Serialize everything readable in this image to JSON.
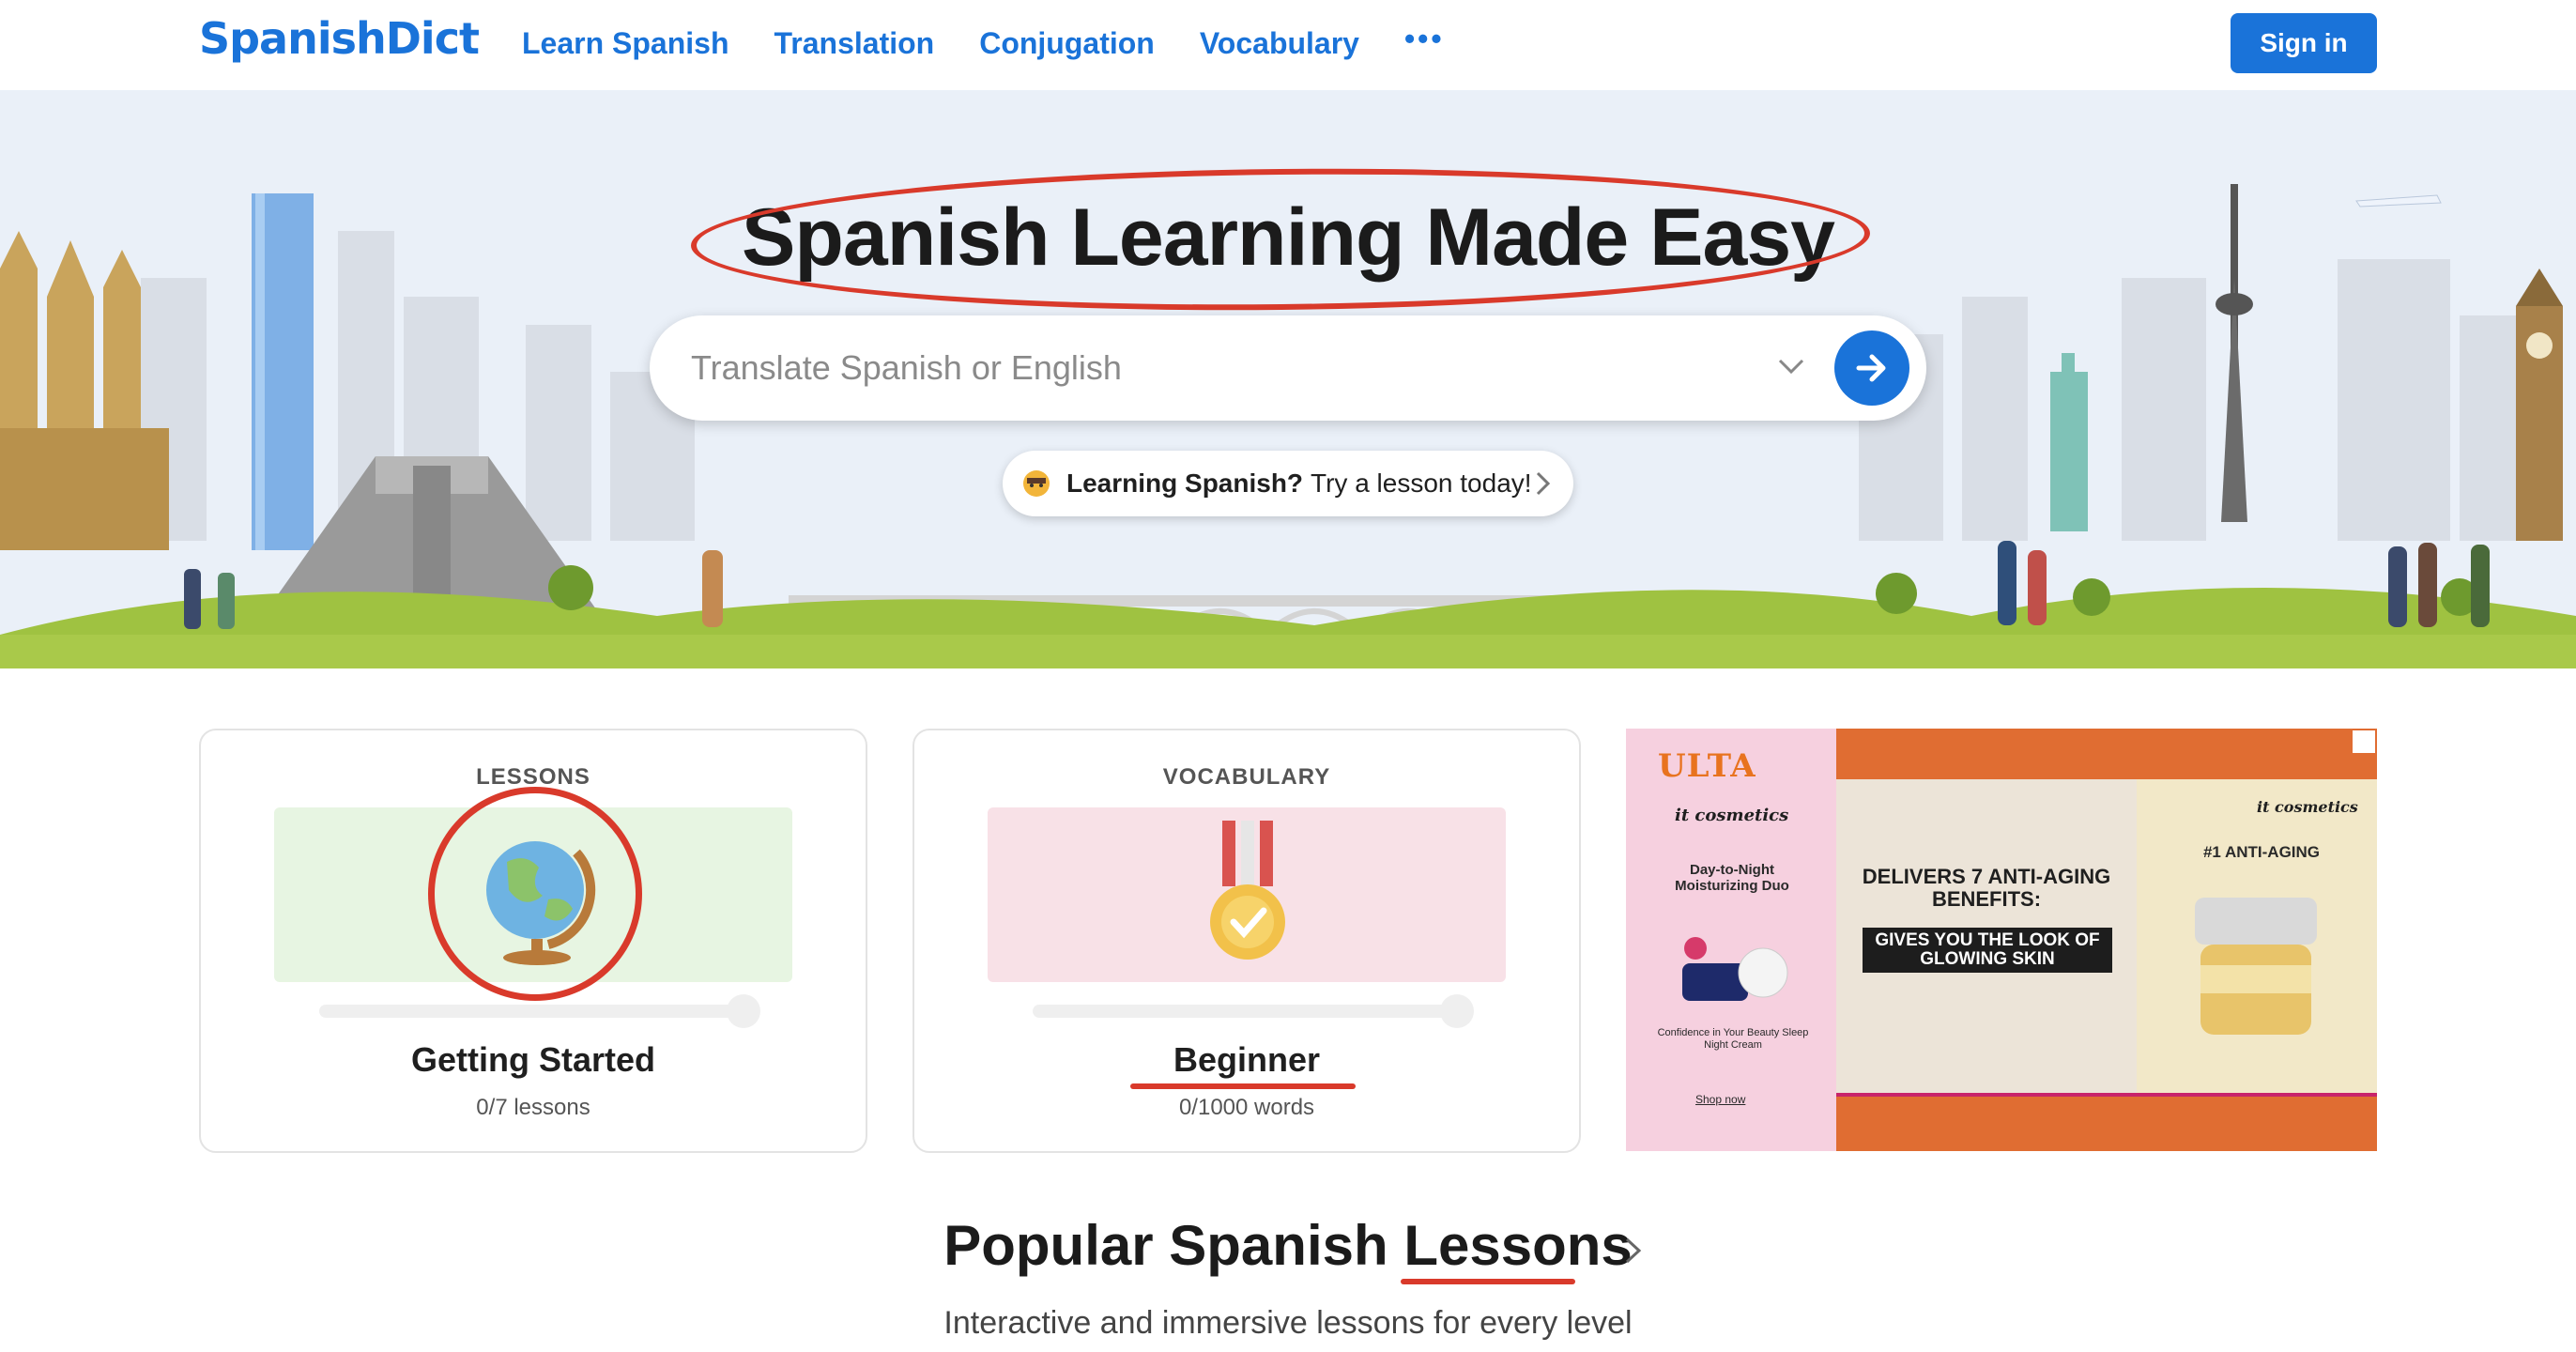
{
  "nav": {
    "logo": "SpanishDict",
    "links": [
      "Learn Spanish",
      "Translation",
      "Conjugation",
      "Vocabulary"
    ],
    "more": "•••",
    "sign_in": "Sign in"
  },
  "hero": {
    "title": "Spanish Learning Made Easy",
    "search_placeholder": "Translate Spanish or English",
    "promo_bold": "Learning Spanish?",
    "promo_text": "Try a lesson today!"
  },
  "cards": [
    {
      "kicker": "LESSONS",
      "title": "Getting Started",
      "sub": "0/7 lessons",
      "progress": 0
    },
    {
      "kicker": "VOCABULARY",
      "title": "Beginner",
      "sub": "0/1000 words",
      "progress": 0
    }
  ],
  "ad": {
    "brand": "ULTA",
    "brand_sub": "it cosmetics",
    "left_heading": "Day-to-Night Moisturizing Duo",
    "left_small": "Confidence in Your Beauty Sleep Night Cream",
    "shop": "Shop now",
    "headline": "DELIVERS 7 ANTI-AGING BENEFITS:",
    "callout": "GIVES YOU THE LOOK OF GLOWING SKIN",
    "right_brand": "it cosmetics",
    "right_heading": "#1 ANTI-AGING"
  },
  "popular": {
    "title": "Popular Spanish Lessons",
    "subtitle": "Interactive and immersive lessons for every level"
  },
  "annotations": {
    "mark_color": "#d93a2b"
  },
  "colors": {
    "brand_blue": "#1a73d9",
    "hero_sky": "#eaf0f8",
    "hero_grass": "#a9c94a"
  }
}
